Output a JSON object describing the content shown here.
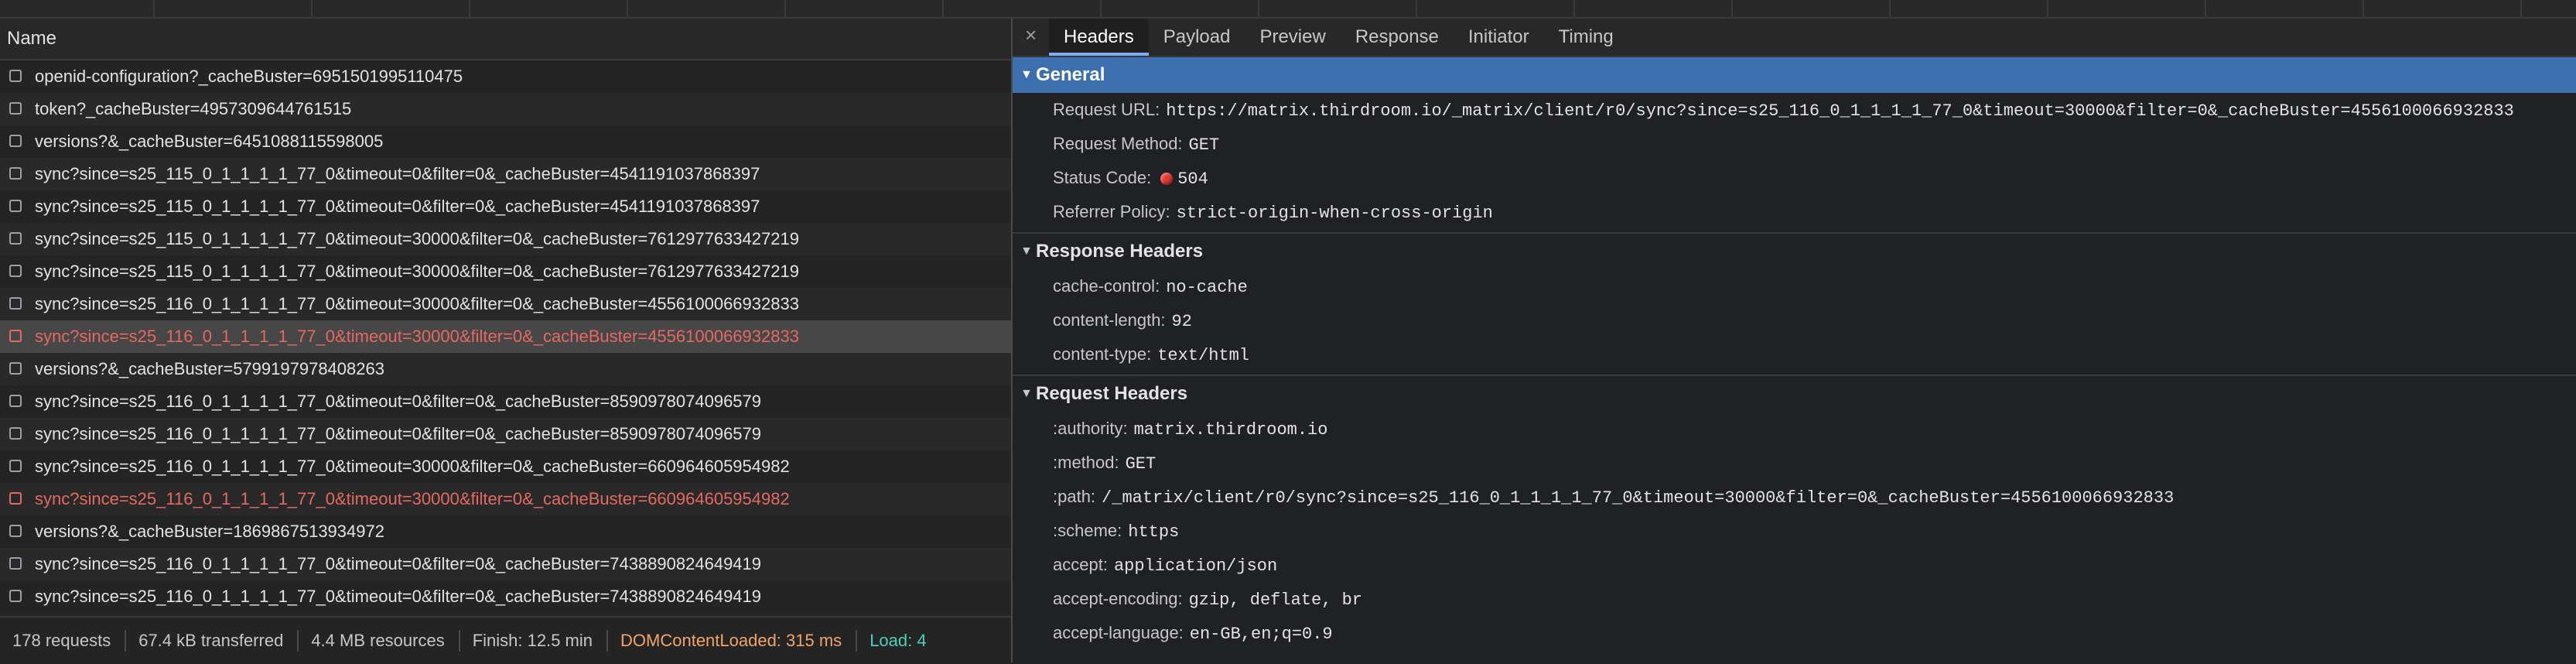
{
  "network": {
    "column_header": "Name",
    "requests": [
      {
        "name": "openid-configuration?_cacheBuster=6951501995110475",
        "status": "ok"
      },
      {
        "name": "token?_cacheBuster=4957309644761515",
        "status": "ok"
      },
      {
        "name": "versions?&_cacheBuster=6451088115598005",
        "status": "ok"
      },
      {
        "name": "sync?since=s25_115_0_1_1_1_1_77_0&timeout=0&filter=0&_cacheBuster=4541191037868397",
        "status": "ok"
      },
      {
        "name": "sync?since=s25_115_0_1_1_1_1_77_0&timeout=0&filter=0&_cacheBuster=4541191037868397",
        "status": "ok"
      },
      {
        "name": "sync?since=s25_115_0_1_1_1_1_77_0&timeout=30000&filter=0&_cacheBuster=7612977633427219",
        "status": "ok"
      },
      {
        "name": "sync?since=s25_115_0_1_1_1_1_77_0&timeout=30000&filter=0&_cacheBuster=7612977633427219",
        "status": "ok"
      },
      {
        "name": "sync?since=s25_116_0_1_1_1_1_77_0&timeout=30000&filter=0&_cacheBuster=4556100066932833",
        "status": "ok"
      },
      {
        "name": "sync?since=s25_116_0_1_1_1_1_77_0&timeout=30000&filter=0&_cacheBuster=4556100066932833",
        "status": "error",
        "selected": true
      },
      {
        "name": "versions?&_cacheBuster=5799197978408263",
        "status": "ok"
      },
      {
        "name": "sync?since=s25_116_0_1_1_1_1_77_0&timeout=0&filter=0&_cacheBuster=8590978074096579",
        "status": "ok"
      },
      {
        "name": "sync?since=s25_116_0_1_1_1_1_77_0&timeout=0&filter=0&_cacheBuster=8590978074096579",
        "status": "ok"
      },
      {
        "name": "sync?since=s25_116_0_1_1_1_1_77_0&timeout=30000&filter=0&_cacheBuster=660964605954982",
        "status": "ok"
      },
      {
        "name": "sync?since=s25_116_0_1_1_1_1_77_0&timeout=30000&filter=0&_cacheBuster=660964605954982",
        "status": "error"
      },
      {
        "name": "versions?&_cacheBuster=1869867513934972",
        "status": "ok"
      },
      {
        "name": "sync?since=s25_116_0_1_1_1_1_77_0&timeout=0&filter=0&_cacheBuster=7438890824649419",
        "status": "ok"
      },
      {
        "name": "sync?since=s25_116_0_1_1_1_1_77_0&timeout=0&filter=0&_cacheBuster=7438890824649419",
        "status": "ok"
      }
    ],
    "footer": {
      "requests": "178 requests",
      "transferred": "67.4 kB transferred",
      "resources": "4.4 MB resources",
      "finish": "Finish: 12.5 min",
      "dom_content_loaded": "DOMContentLoaded: 315 ms",
      "load": "Load: 4"
    }
  },
  "details": {
    "close_glyph": "×",
    "tabs": [
      "Headers",
      "Payload",
      "Preview",
      "Response",
      "Initiator",
      "Timing"
    ],
    "active_tab": "Headers",
    "general": {
      "title": "General",
      "request_url_key": "Request URL:",
      "request_url": "https://matrix.thirdroom.io/_matrix/client/r0/sync?since=s25_116_0_1_1_1_1_77_0&timeout=30000&filter=0&_cacheBuster=4556100066932833",
      "request_method_key": "Request Method:",
      "request_method": "GET",
      "status_code_key": "Status Code:",
      "status_code": "504",
      "referrer_policy_key": "Referrer Policy:",
      "referrer_policy": "strict-origin-when-cross-origin"
    },
    "response_headers": {
      "title": "Response Headers",
      "items": [
        {
          "key": "cache-control:",
          "value": "no-cache"
        },
        {
          "key": "content-length:",
          "value": "92"
        },
        {
          "key": "content-type:",
          "value": "text/html"
        }
      ]
    },
    "request_headers": {
      "title": "Request Headers",
      "items": [
        {
          "key": ":authority:",
          "value": "matrix.thirdroom.io"
        },
        {
          "key": ":method:",
          "value": "GET"
        },
        {
          "key": ":path:",
          "value": "/_matrix/client/r0/sync?since=s25_116_0_1_1_1_1_77_0&timeout=30000&filter=0&_cacheBuster=4556100066932833"
        },
        {
          "key": ":scheme:",
          "value": "https"
        },
        {
          "key": "accept:",
          "value": "application/json"
        },
        {
          "key": "accept-encoding:",
          "value": "gzip, deflate, br"
        },
        {
          "key": "accept-language:",
          "value": "en-GB,en;q=0.9"
        }
      ]
    }
  },
  "colors": {
    "error": "#e46962",
    "selected_section": "#3c6fae",
    "dom_content_loaded": "#f2a46a",
    "load": "#4ed0b8"
  }
}
